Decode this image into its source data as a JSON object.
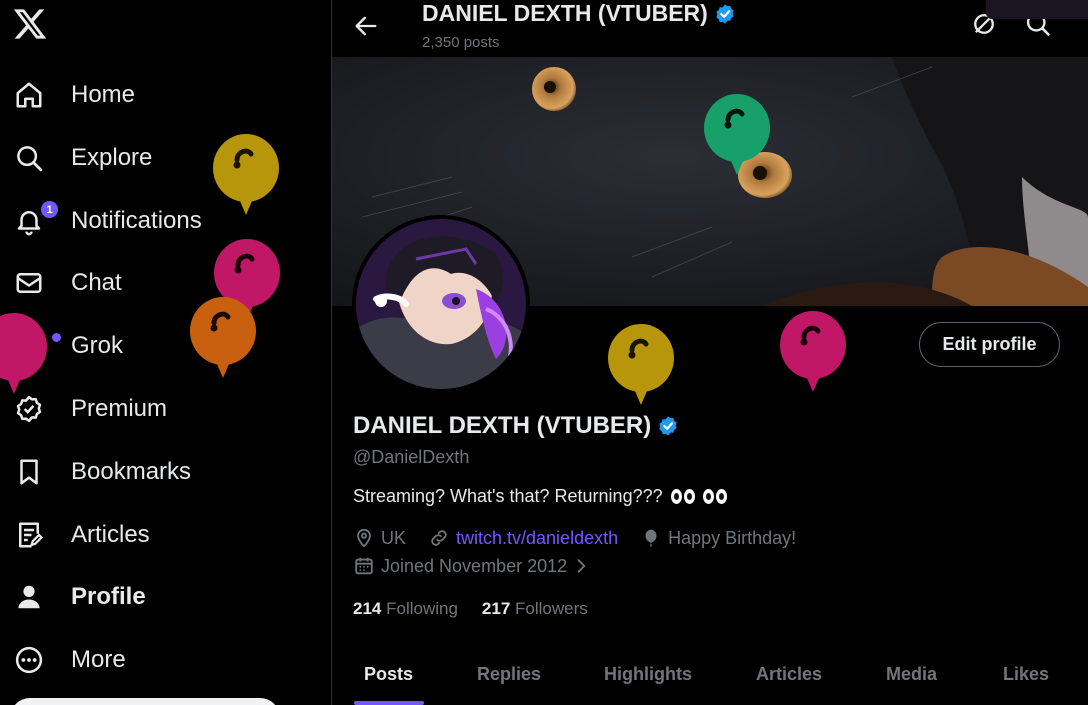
{
  "sidebar": {
    "logo": "x-logo-icon",
    "items": [
      {
        "label": "Home",
        "icon": "home-icon"
      },
      {
        "label": "Explore",
        "icon": "search-icon"
      },
      {
        "label": "Notifications",
        "icon": "bell-icon",
        "badge": "1"
      },
      {
        "label": "Chat",
        "icon": "mail-icon"
      },
      {
        "label": "Grok",
        "icon": "grok-icon"
      },
      {
        "label": "Premium",
        "icon": "verified-badge-icon"
      },
      {
        "label": "Bookmarks",
        "icon": "bookmark-icon"
      },
      {
        "label": "Articles",
        "icon": "article-icon"
      },
      {
        "label": "Profile",
        "icon": "person-icon"
      },
      {
        "label": "More",
        "icon": "more-circle-icon"
      }
    ]
  },
  "header": {
    "name": "DANIEL DEXTH (VTUBER)",
    "posts_count": "2,350 posts"
  },
  "profile": {
    "display_name": "DANIEL DEXTH (VTUBER)",
    "handle": "@DanielDexth",
    "bio": "Streaming? What's that? Returning???",
    "location": "UK",
    "website": "twitch.tv/danieldexth",
    "birthday": "Happy Birthday!",
    "joined": "Joined November 2012",
    "following_count": "214",
    "following_label": "Following",
    "followers_count": "217",
    "followers_label": "Followers",
    "edit_button": "Edit profile"
  },
  "tabs": [
    "Posts",
    "Replies",
    "Highlights",
    "Articles",
    "Media",
    "Likes"
  ],
  "active_tab": "Posts",
  "colors": {
    "accent": "#7856ff",
    "verified": "#1d9bf0",
    "text": "#e7e9ea",
    "muted": "#71767b",
    "balloon_gold": "#b8960c",
    "balloon_magenta": "#c01866",
    "balloon_orange": "#c9600f",
    "balloon_green": "#17a06a"
  }
}
